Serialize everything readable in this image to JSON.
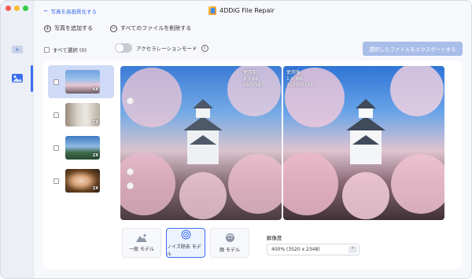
{
  "app": {
    "title": "4DDiG File Repair",
    "back_label": "写真を高画質化する"
  },
  "actions": {
    "add_photo": "写真を追加する",
    "delete_all": "すべてのファイルを削除する"
  },
  "toolbar": {
    "select_all": "すべて選択 (0)",
    "accel_mode": "アクセラレーションモード",
    "export": "選択したファイルをエクスポートする"
  },
  "thumbnails": [
    {
      "badge": "4X",
      "selected": true
    },
    {
      "badge": "2X",
      "selected": false
    },
    {
      "badge": "2X",
      "selected": false
    },
    {
      "badge": "2X",
      "selected": false
    }
  ],
  "compare": {
    "before": {
      "label": "使用前",
      "size": "4.3 KB",
      "dims": "880x587"
    },
    "after": {
      "label": "使用後",
      "size": "1.6 MB",
      "dims": "3520x2348"
    }
  },
  "models": [
    {
      "label": "一般 モデル",
      "icon": "landscape-icon",
      "active": false
    },
    {
      "label": "ノイズ除去 モデル",
      "icon": "denoise-icon",
      "active": true
    },
    {
      "label": "顔 モデル",
      "icon": "face-icon",
      "active": false
    }
  ],
  "resolution": {
    "label": "解像度",
    "value": "400% (3520 x 2348)"
  },
  "colors": {
    "accent": "#3a6df0",
    "export_disabled": "#a9bde9"
  }
}
